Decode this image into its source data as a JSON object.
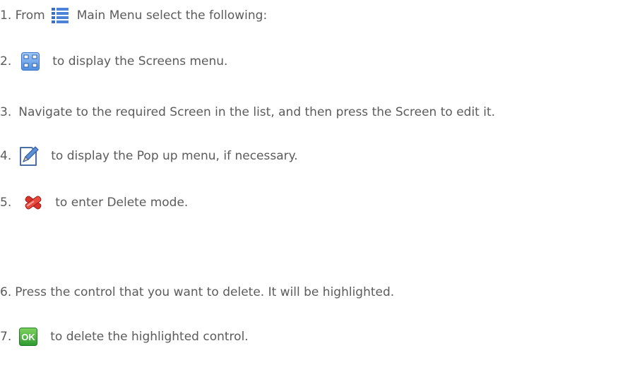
{
  "steps": [
    {
      "num": "1. From",
      "text": "Main Menu select the following:",
      "icon": "main-menu-list-icon"
    },
    {
      "num": "2.",
      "text": "to display the Screens menu.",
      "icon": "screens-grid-icon"
    },
    {
      "num": "3.",
      "text": "Navigate to the required Screen in the list, and then press the Screen to edit it.",
      "icon": ""
    },
    {
      "num": "4.",
      "text": "to display the Pop up menu, if necessary.",
      "icon": "edit-pencil-icon"
    },
    {
      "num": "5.",
      "text": "to enter Delete mode.",
      "icon": "delete-x-icon"
    },
    {
      "num": "6.",
      "text": "Press the control that you want to delete. It will be highlighted.",
      "icon": ""
    },
    {
      "num": "7.",
      "text": "to delete the highlighted control.",
      "icon": "ok-button-icon"
    }
  ],
  "ok_icon_label": "OK",
  "colors": {
    "text": "#5b5b5b",
    "menu_blue": "#3a6fc4",
    "grid_blue": "#4f8fe0",
    "delete_red": "#d9342b",
    "ok_green": "#3cae3a"
  }
}
